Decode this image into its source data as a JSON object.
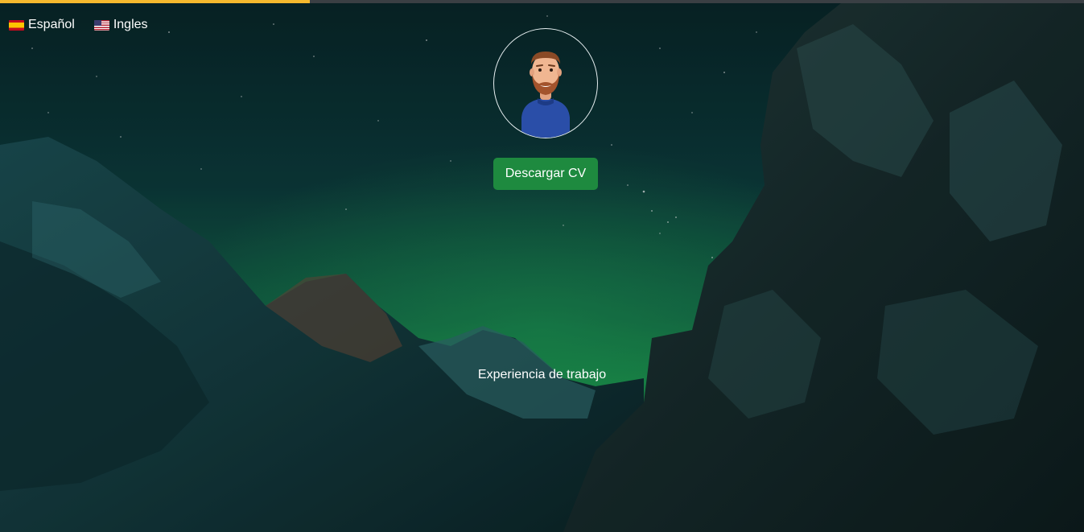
{
  "colors": {
    "progress": "#f5b82e",
    "button": "#1e8a3f",
    "text": "#ffffff"
  },
  "progress": {
    "value_percent": 28.6
  },
  "languages": [
    {
      "label": "Español",
      "flag": "flag-es-icon"
    },
    {
      "label": "Ingles",
      "flag": "flag-us-icon"
    }
  ],
  "hero": {
    "avatar_icon": "bearded-man-avatar-icon",
    "download_label": "Descargar CV"
  },
  "sections": {
    "work_title": "Experiencia de trabajo"
  }
}
